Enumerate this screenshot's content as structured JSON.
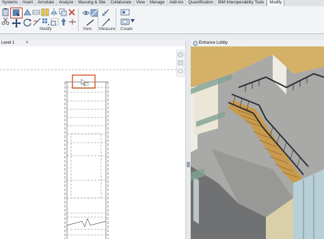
{
  "tabs": [
    "Systems",
    "Insert",
    "Annotate",
    "Analyze",
    "Massing & Site",
    "Collaborate",
    "View",
    "Manage",
    "Add-Ins",
    "Quantification",
    "BIM Interoperability Tools",
    "Modify"
  ],
  "active_tab": "Modify",
  "ribbon": {
    "groups": {
      "modify": "Modify",
      "view": "View",
      "measure": "Measure",
      "create": "Create"
    }
  },
  "views": {
    "left_tab": "Level 1",
    "right_tab": "Entrance Lobby"
  },
  "colors": {
    "selection": "#d0531f",
    "ribbon_bg": "#f3f4f6",
    "floor_wood": "#d6b46a",
    "railing": "#2b2f33"
  },
  "icons": {
    "modify": "arrow-cursor-icon",
    "move": "move-icon",
    "copy": "copy-icon",
    "rotate": "rotate-icon",
    "measure": "measure-icon",
    "create": "create-group-icon",
    "nav_wheel": "navigation-wheel-icon",
    "view_cube": "view-cube-icon"
  }
}
